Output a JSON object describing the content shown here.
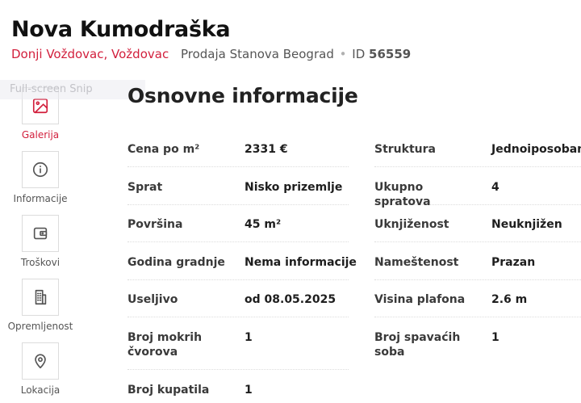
{
  "listing": {
    "title": "Nova Kumodraška",
    "location": "Donji Voždovac, Voždovac",
    "category": "Prodaja Stanova Beograd",
    "separator": "•",
    "id_label": "ID",
    "id_value": "56559"
  },
  "overlay": {
    "snip_text": "Full-screen Snip"
  },
  "sidebar": {
    "items": [
      {
        "label": "Galerija",
        "icon": "image-icon",
        "active": true
      },
      {
        "label": "Informacije",
        "icon": "info-icon",
        "active": false
      },
      {
        "label": "Troškovi",
        "icon": "wallet-icon",
        "active": false
      },
      {
        "label": "Opremljenost",
        "icon": "building-icon",
        "active": false
      },
      {
        "label": "Lokacija",
        "icon": "map-pin-icon",
        "active": false
      }
    ]
  },
  "section": {
    "title": "Osnovne informacije"
  },
  "info_left": [
    {
      "label": "Cena po m²",
      "value": "2331 €"
    },
    {
      "label": "Sprat",
      "value": "Nisko prizemlje"
    },
    {
      "label": "Površina",
      "value": "45 m²"
    },
    {
      "label": "Godina gradnje",
      "value": "Nema informacije"
    },
    {
      "label": "Useljivo",
      "value": "od 08.05.2025"
    },
    {
      "label": "Broj mokrih čvorova",
      "value": "1"
    },
    {
      "label": "Broj kupatila",
      "value": "1"
    }
  ],
  "info_right": [
    {
      "label": "Struktura",
      "value": "Jednoiposoban"
    },
    {
      "label": "Ukupno spratova",
      "value": "4"
    },
    {
      "label": "Uknjiženost",
      "value": "Neuknjižen"
    },
    {
      "label": "Nameštenost",
      "value": "Prazan"
    },
    {
      "label": "Visina plafona",
      "value": "2.6 m"
    },
    {
      "label": "Broj spavaćih soba",
      "value": "1"
    }
  ],
  "colors": {
    "accent": "#d21f3c",
    "text": "#2b2b2b",
    "border": "#dcdcdc"
  }
}
